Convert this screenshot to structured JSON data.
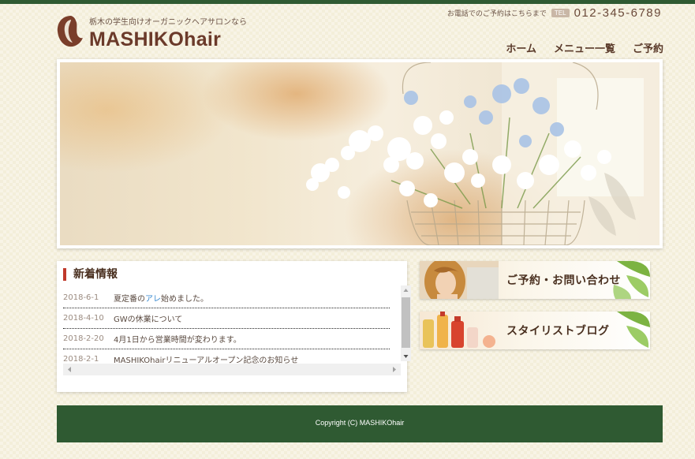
{
  "header": {
    "tagline": "栃木の学生向けオーガニックヘアサロンなら",
    "site_title": "MASHIKOhair",
    "phone_note": "お電話でのご予約はこちらまで",
    "tel_label": "TEL",
    "phone_number": "012-345-6789",
    "nav": [
      {
        "label": "ホーム"
      },
      {
        "label": "メニュー一覧"
      },
      {
        "label": "ご予約"
      }
    ]
  },
  "news": {
    "heading": "新着情報",
    "items": [
      {
        "date": "2018-6-1",
        "text_before": "夏定番の",
        "link": "アレ",
        "text_after": "始めました。"
      },
      {
        "date": "2018-4-10",
        "text_before": "GWの休業について",
        "link": "",
        "text_after": ""
      },
      {
        "date": "2018-2-20",
        "text_before": "4月1日から営業時間が変わります。",
        "link": "",
        "text_after": ""
      },
      {
        "date": "2018-2-1",
        "text_before": "MASHIKOhairリニューアルオープン記念のお知らせ",
        "link": "",
        "text_after": ""
      }
    ]
  },
  "banners": {
    "reservation": "ご予約・お問い合わせ",
    "blog": "スタイリストブログ"
  },
  "footer": {
    "copyright": "Copyright (C) MASHIKOhair"
  },
  "colors": {
    "brand_green": "#2f5a32",
    "accent_red": "#c0392b",
    "title_brown": "#6b3a2a"
  }
}
